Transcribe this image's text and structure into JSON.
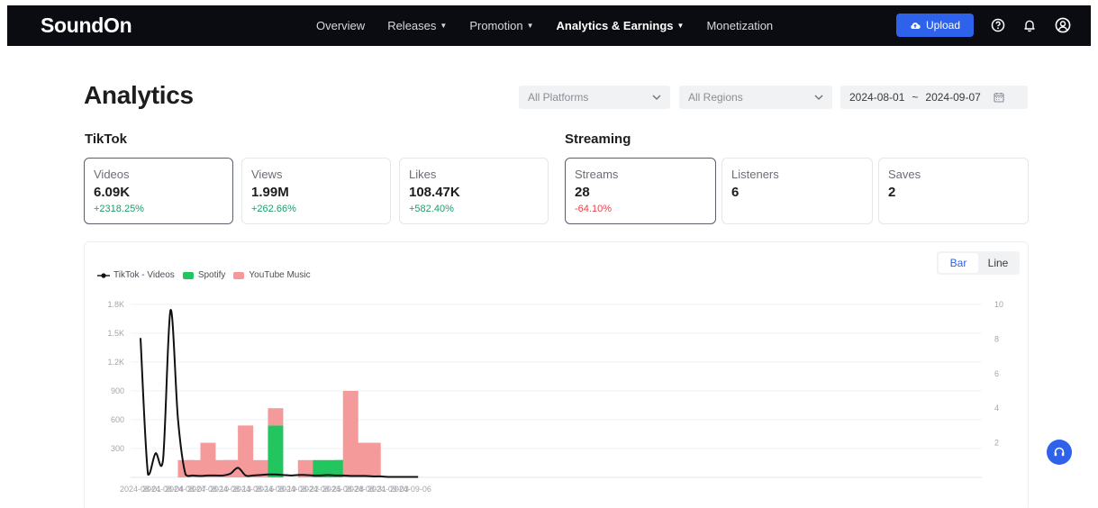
{
  "brand": {
    "name": "SoundOn"
  },
  "nav": {
    "items": [
      {
        "label": "Overview",
        "dropdown": false,
        "active": false
      },
      {
        "label": "Releases",
        "dropdown": true,
        "active": false
      },
      {
        "label": "Promotion",
        "dropdown": true,
        "active": false
      },
      {
        "label": "Analytics & Earnings",
        "dropdown": true,
        "active": true
      },
      {
        "label": "Monetization",
        "dropdown": false,
        "active": false
      }
    ],
    "upload_label": "Upload",
    "icons": [
      "help-icon",
      "bell-icon",
      "account-icon"
    ]
  },
  "page": {
    "title": "Analytics",
    "filters": {
      "platform": "All Platforms",
      "region": "All Regions",
      "date_start": "2024-08-01",
      "date_sep": "~",
      "date_end": "2024-09-07"
    }
  },
  "tiktok": {
    "title": "TikTok",
    "cards": [
      {
        "label": "Videos",
        "value": "6.09K",
        "change": "+2318.25%",
        "dir": "up",
        "selected": true
      },
      {
        "label": "Views",
        "value": "1.99M",
        "change": "+262.66%",
        "dir": "up",
        "selected": false
      },
      {
        "label": "Likes",
        "value": "108.47K",
        "change": "+582.40%",
        "dir": "up",
        "selected": false
      }
    ]
  },
  "streaming": {
    "title": "Streaming",
    "cards": [
      {
        "label": "Streams",
        "value": "28",
        "change": "-64.10%",
        "dir": "down",
        "selected": true
      },
      {
        "label": "Listeners",
        "value": "6",
        "change": "",
        "dir": "",
        "selected": false
      },
      {
        "label": "Saves",
        "value": "2",
        "change": "",
        "dir": "",
        "selected": false
      }
    ]
  },
  "chart_toggle": {
    "bar": "Bar",
    "line": "Line",
    "active": "bar"
  },
  "colors": {
    "accent": "#2f62ea",
    "spotify": "#22c55e",
    "youtube_music": "#f59a9a",
    "tiktok": "#111111",
    "up": "#1f9d6b",
    "down": "#e0464a"
  },
  "chart_data": {
    "type": "bar",
    "legend": [
      "TikTok - Videos",
      "Spotify",
      "YouTube Music"
    ],
    "y_left_ticks": [
      "300",
      "600",
      "900",
      "1.2K",
      "1.5K",
      "1.8K"
    ],
    "y_left_lim": [
      0,
      1800
    ],
    "y_right_ticks": [
      "2",
      "4",
      "6",
      "8",
      "10"
    ],
    "y_right_lim": [
      0,
      10
    ],
    "x_tick_labels": [
      "2024-08-01",
      "2024-08-04",
      "2024-08-07",
      "2024-08-10",
      "2024-08-13",
      "2024-08-16",
      "2024-08-19",
      "2024-08-22",
      "2024-08-25",
      "2024-08-28",
      "2024-08-31",
      "2024-09-03",
      "2024-09-06"
    ],
    "categories": [
      "2024-08-01",
      "2024-08-02",
      "2024-08-03",
      "2024-08-04",
      "2024-08-05",
      "2024-08-06",
      "2024-08-07",
      "2024-08-08",
      "2024-08-09",
      "2024-08-10",
      "2024-08-11",
      "2024-08-12",
      "2024-08-13",
      "2024-08-14",
      "2024-08-15",
      "2024-08-16",
      "2024-08-17",
      "2024-08-18",
      "2024-08-19",
      "2024-08-20",
      "2024-08-21",
      "2024-08-22",
      "2024-08-23",
      "2024-08-24",
      "2024-08-25",
      "2024-08-26",
      "2024-08-27",
      "2024-08-28",
      "2024-08-29",
      "2024-08-30",
      "2024-08-31",
      "2024-09-01",
      "2024-09-02",
      "2024-09-03",
      "2024-09-04",
      "2024-09-05",
      "2024-09-06",
      "2024-09-07"
    ],
    "series": [
      {
        "name": "TikTok - Videos",
        "axis": "left",
        "kind": "line",
        "values": [
          1450,
          30,
          250,
          180,
          1740,
          600,
          30,
          20,
          15,
          20,
          20,
          20,
          40,
          100,
          20,
          20,
          25,
          30,
          30,
          25,
          20,
          25,
          25,
          20,
          20,
          25,
          20,
          20,
          15,
          15,
          15,
          10,
          10,
          5,
          5,
          5,
          5,
          5
        ]
      },
      {
        "name": "Spotify",
        "axis": "right",
        "kind": "bar",
        "values": [
          0,
          0,
          0,
          0,
          0,
          0,
          0,
          0,
          0,
          0,
          0,
          0,
          0,
          0,
          0,
          0,
          0,
          0,
          3,
          0,
          0,
          0,
          0,
          0,
          1,
          0,
          1,
          1,
          0,
          0,
          0,
          0,
          0,
          0,
          0,
          0,
          0,
          0
        ]
      },
      {
        "name": "YouTube Music",
        "axis": "right",
        "kind": "bar",
        "values": [
          0,
          0,
          0,
          0,
          0,
          0,
          1,
          1,
          0,
          2,
          0,
          1,
          1,
          1,
          3,
          0,
          1,
          0,
          1,
          0,
          0,
          0,
          1,
          0,
          0,
          0,
          0,
          0,
          5,
          0,
          2,
          2,
          0,
          0,
          0,
          0,
          0,
          0
        ]
      }
    ]
  }
}
